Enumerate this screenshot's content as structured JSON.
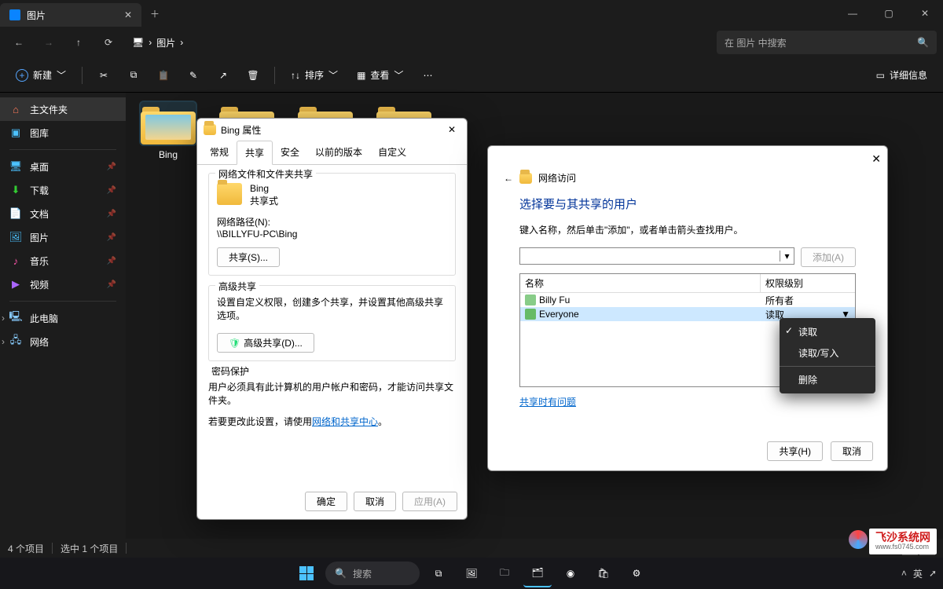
{
  "titlebar": {
    "tab_label": "图片"
  },
  "nav": {
    "crumb_monitor": "🖥",
    "crumb_sep": "›",
    "crumb_pictures": "图片",
    "search_placeholder": "在 图片 中搜索"
  },
  "toolbar": {
    "new": "新建",
    "sort": "排序",
    "view": "查看",
    "details": "详细信息"
  },
  "sidebar": {
    "home": "主文件夹",
    "gallery": "图库",
    "desktop": "桌面",
    "downloads": "下载",
    "documents": "文档",
    "pictures": "图片",
    "music": "音乐",
    "videos": "视频",
    "thispc": "此电脑",
    "network": "网络"
  },
  "folders": {
    "bing": "Bing"
  },
  "status": {
    "count": "4 个项目",
    "selected": "选中 1 个项目"
  },
  "prop": {
    "title": "Bing 属性",
    "tabs": {
      "general": "常规",
      "sharing": "共享",
      "security": "安全",
      "previous": "以前的版本",
      "custom": "自定义"
    },
    "group1_title": "网络文件和文件夹共享",
    "folder_name": "Bing",
    "share_state": "共享式",
    "path_label": "网络路径(N):",
    "path_value": "\\\\BILLYFU-PC\\Bing",
    "share_btn": "共享(S)...",
    "group2_title": "高级共享",
    "group2_text": "设置自定义权限，创建多个共享，并设置其他高级共享选项。",
    "adv_btn": "高级共享(D)...",
    "group3_title": "密码保护",
    "group3_text1": "用户必须具有此计算机的用户帐户和密码，才能访问共享文件夹。",
    "group3_text2_a": "若要更改此设置，请使用",
    "group3_link": "网络和共享中心",
    "ok": "确定",
    "cancel": "取消",
    "apply": "应用(A)"
  },
  "net": {
    "back": "←",
    "title": "网络访问",
    "heading": "选择要与其共享的用户",
    "subtext": "键入名称，然后单击\"添加\"，或者单击箭头查找用户。",
    "add_btn": "添加(A)",
    "col_name": "名称",
    "col_perm": "权限级别",
    "user1": "Billy Fu",
    "perm1": "所有者",
    "user2": "Everyone",
    "perm2": "读取",
    "trouble": "共享时有问题",
    "share": "共享(H)",
    "cancel": "取消"
  },
  "permmenu": {
    "read": "读取",
    "readwrite": "读取/写入",
    "remove": "删除"
  },
  "taskbar": {
    "search": "搜索"
  },
  "tray": {
    "lang": "英",
    "ime": "➚"
  },
  "watermark": {
    "text": "飞沙系统网",
    "url": "www.fs0745.com"
  }
}
